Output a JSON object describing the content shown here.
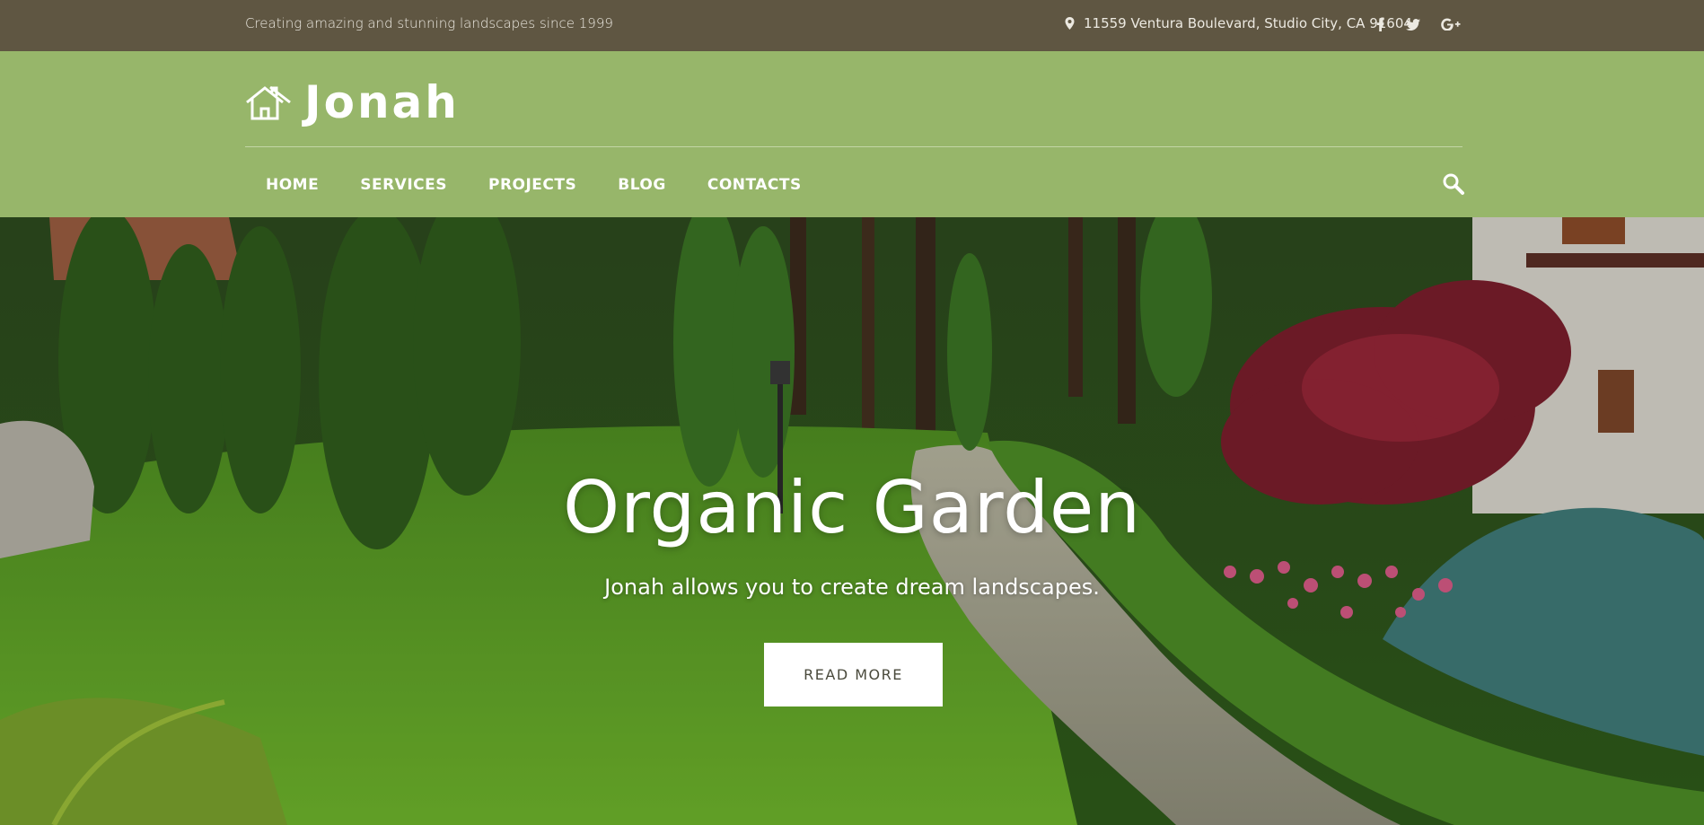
{
  "topbar": {
    "tagline": "Creating amazing and stunning landscapes since 1999",
    "address": "11559 Ventura Boulevard, Studio City, CA 91604",
    "social": [
      {
        "name": "facebook-icon",
        "glyph": "f"
      },
      {
        "name": "twitter-icon",
        "glyph": "t"
      },
      {
        "name": "google-plus-icon",
        "glyph": "G+"
      }
    ]
  },
  "header": {
    "logo_text": "Jonah",
    "nav": [
      "HOME",
      "SERVICES",
      "PROJECTS",
      "BLOG",
      "CONTACTS"
    ]
  },
  "hero": {
    "title": "Organic Garden",
    "subtitle": "Jonah allows you to create dream landscapes.",
    "button_label": "READ MORE"
  },
  "colors": {
    "topbar_bg": "#5f5642",
    "header_bg": "#97b66a",
    "button_bg": "#ffffff"
  }
}
